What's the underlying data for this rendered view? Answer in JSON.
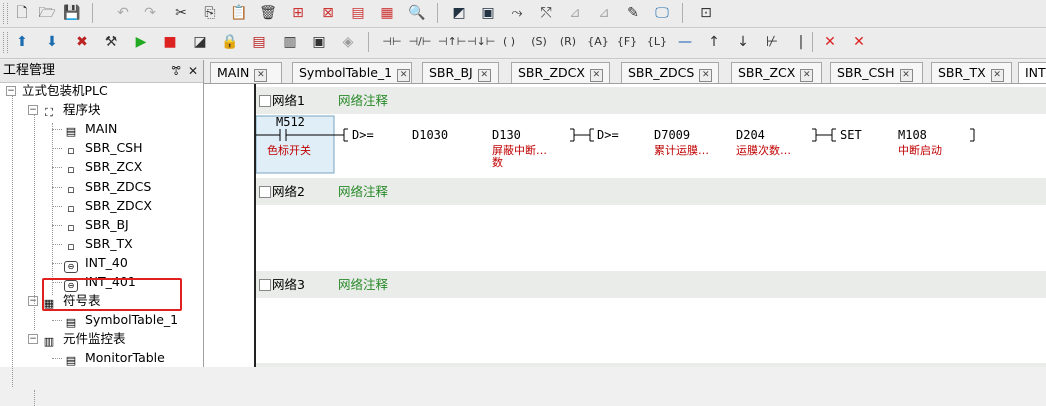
{
  "toolbar1": {
    "icons": [
      "new-file-icon",
      "open-icon",
      "save-icon",
      "undo-icon",
      "redo-icon",
      "cut-icon",
      "copy-icon",
      "paste-icon",
      "delete-icon",
      "insert-row-icon",
      "delete-row-icon",
      "compile-icon",
      "compile-all-icon",
      "find-icon",
      "ladder-view-icon",
      "instruction-list-icon",
      "zoom-in-icon",
      "zoom-out-icon",
      "chart-icon",
      "chart2-icon",
      "edit-chart-icon",
      "monitor-icon",
      "network-icon"
    ]
  },
  "toolbar2": {
    "icons": [
      "upload-icon",
      "download-icon",
      "tools-icon",
      "hammer-icon",
      "run-icon",
      "stop-icon",
      "erase-icon",
      "lock-icon",
      "monitor-on-icon",
      "monitor-off-icon",
      "status-icon",
      "force-icon"
    ],
    "ladder": [
      "⊣⊢",
      "⊣/⊢",
      "⊣↑⊢",
      "⊣↓⊢",
      "( )",
      "(S)",
      "(R)",
      "{A}",
      "{F}",
      "{L}",
      "—",
      "↑",
      "↓",
      "⊬",
      "|",
      "✕",
      "✕"
    ]
  },
  "panel": {
    "title": "工程管理",
    "pin": "ꔅ",
    "close": "✕",
    "tree": [
      {
        "label": "立式包装机PLC",
        "level": 0,
        "icon": "plc-icon",
        "expander": "−"
      },
      {
        "label": "程序块",
        "level": 1,
        "icon": "program-block-icon",
        "expander": "−"
      },
      {
        "label": "MAIN",
        "level": 2,
        "icon": "main-program-icon"
      },
      {
        "label": "SBR_CSH",
        "level": 2,
        "icon": "subroutine-icon"
      },
      {
        "label": "SBR_ZCX",
        "level": 2,
        "icon": "subroutine-icon"
      },
      {
        "label": "SBR_ZDCS",
        "level": 2,
        "icon": "subroutine-icon"
      },
      {
        "label": "SBR_ZDCX",
        "level": 2,
        "icon": "subroutine-icon"
      },
      {
        "label": "SBR_BJ",
        "level": 2,
        "icon": "subroutine-icon"
      },
      {
        "label": "SBR_TX",
        "level": 2,
        "icon": "subroutine-icon"
      },
      {
        "label": "INT_40",
        "level": 2,
        "icon": "interrupt-icon"
      },
      {
        "label": "INT_401",
        "level": 2,
        "icon": "interrupt-icon"
      },
      {
        "label": "符号表",
        "level": 1,
        "icon": "symbol-table-icon",
        "expander": "−"
      },
      {
        "label": "SymbolTable_1",
        "level": 2,
        "icon": "table-icon"
      },
      {
        "label": "元件监控表",
        "level": 1,
        "icon": "monitor-table-icon",
        "expander": "−"
      },
      {
        "label": "MonitorTable",
        "level": 2,
        "icon": "table-icon"
      }
    ]
  },
  "tabs": [
    "MAIN",
    "SymbolTable_1",
    "SBR_BJ",
    "SBR_ZDCX",
    "SBR_ZDCS",
    "SBR_ZCX",
    "SBR_CSH",
    "SBR_TX",
    "INT"
  ],
  "networks": [
    {
      "name": "网络1",
      "comment": "网络注释"
    },
    {
      "name": "网络2",
      "comment": "网络注释"
    },
    {
      "name": "网络3",
      "comment": "网络注释"
    }
  ],
  "rung1": {
    "contact": "M512",
    "contact_comment": "色标开关",
    "cmp1_op": "D>=",
    "cmp1_a": "D1030",
    "cmp1_b": "D130",
    "cmp1_b_comment": "屏蔽中断…",
    "cmp1_b_comment2": "数",
    "cmp2_op": "D>=",
    "cmp2_a": "D7009",
    "cmp2_a_comment": "累计运膜…",
    "cmp2_b": "D204",
    "cmp2_b_comment": "运膜次数…",
    "coil_op": "SET",
    "coil_target": "M108",
    "coil_comment": "中断启动"
  }
}
